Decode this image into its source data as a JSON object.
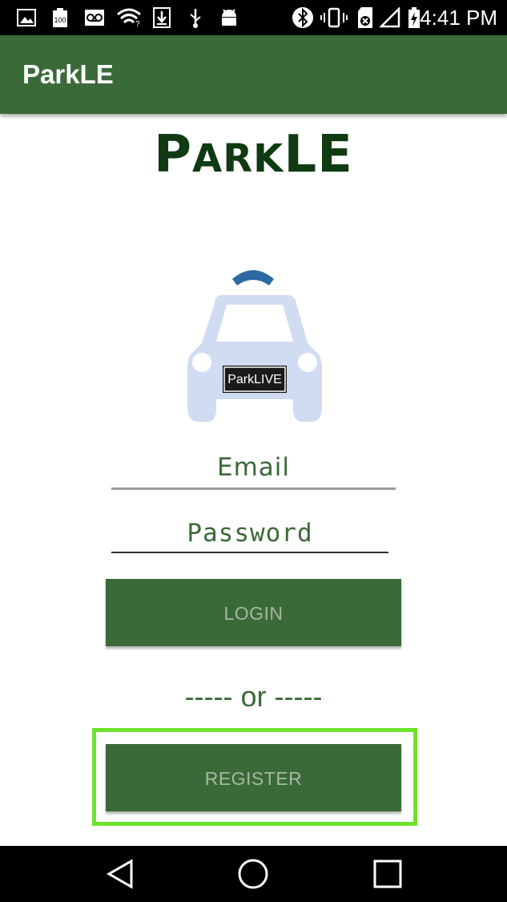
{
  "status_bar": {
    "time": "4:41 PM",
    "icons": [
      "image-icon",
      "battery-100-icon",
      "voicemail-icon",
      "wifi-icon",
      "download-icon",
      "usb-icon",
      "android-icon",
      "bluetooth-icon",
      "vibrate-icon",
      "sim-icon",
      "signal-icon",
      "battery-charging-icon"
    ]
  },
  "app_bar": {
    "title": "ParkLE"
  },
  "logo": {
    "first": "P",
    "rest": "ARK",
    "tail": "LE"
  },
  "car_badge": "ParkLIVE",
  "form": {
    "email_placeholder": "Email",
    "password_placeholder": "Password",
    "login_label": "LOGIN",
    "separator": "----- or -----",
    "register_label": "REGISTER"
  },
  "nav_bar": {
    "icons": [
      "back-icon",
      "home-icon",
      "recents-icon"
    ]
  },
  "colors": {
    "primary": "#3a6a37",
    "logo": "#0f3a12",
    "highlight": "#6ee12b"
  }
}
